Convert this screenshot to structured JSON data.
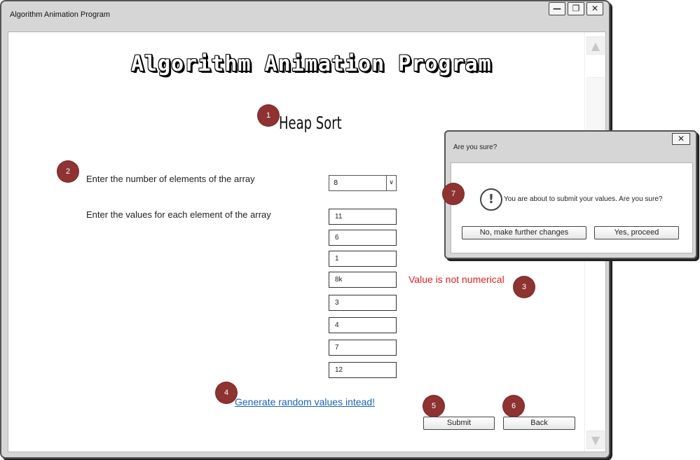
{
  "window": {
    "title": "Algorithm Animation Program",
    "controls": {
      "minimize": "—",
      "maximize": "❐",
      "close": "✕"
    }
  },
  "app_title": "Algorithm Animation Program",
  "heading": "Heap Sort",
  "labels": {
    "num_elements": "Enter the number of elements of the array",
    "values": "Enter the values for each element of the array"
  },
  "num_elements_select": {
    "selected": "8",
    "arrow": "∨"
  },
  "values": [
    "11",
    "6",
    "1",
    "8k",
    "3",
    "4",
    "7",
    "12"
  ],
  "error_message": "Value is not numerical",
  "random_link": "Generate random values intead!",
  "buttons": {
    "submit": "Submit",
    "back": "Back"
  },
  "markers": [
    "1",
    "2",
    "3",
    "4",
    "5",
    "6",
    "7"
  ],
  "dialog": {
    "title": "Are you sure?",
    "close": "✕",
    "icon": "!",
    "message": "You are about to submit your values. Are you sure?",
    "no_button": "No, make further changes",
    "yes_button": "Yes, proceed"
  },
  "colors": {
    "marker": "#8e3232",
    "error": "#e02020",
    "link": "#1a63b8"
  },
  "icons": {
    "scroll_up": "▲",
    "scroll_down": "▼"
  }
}
